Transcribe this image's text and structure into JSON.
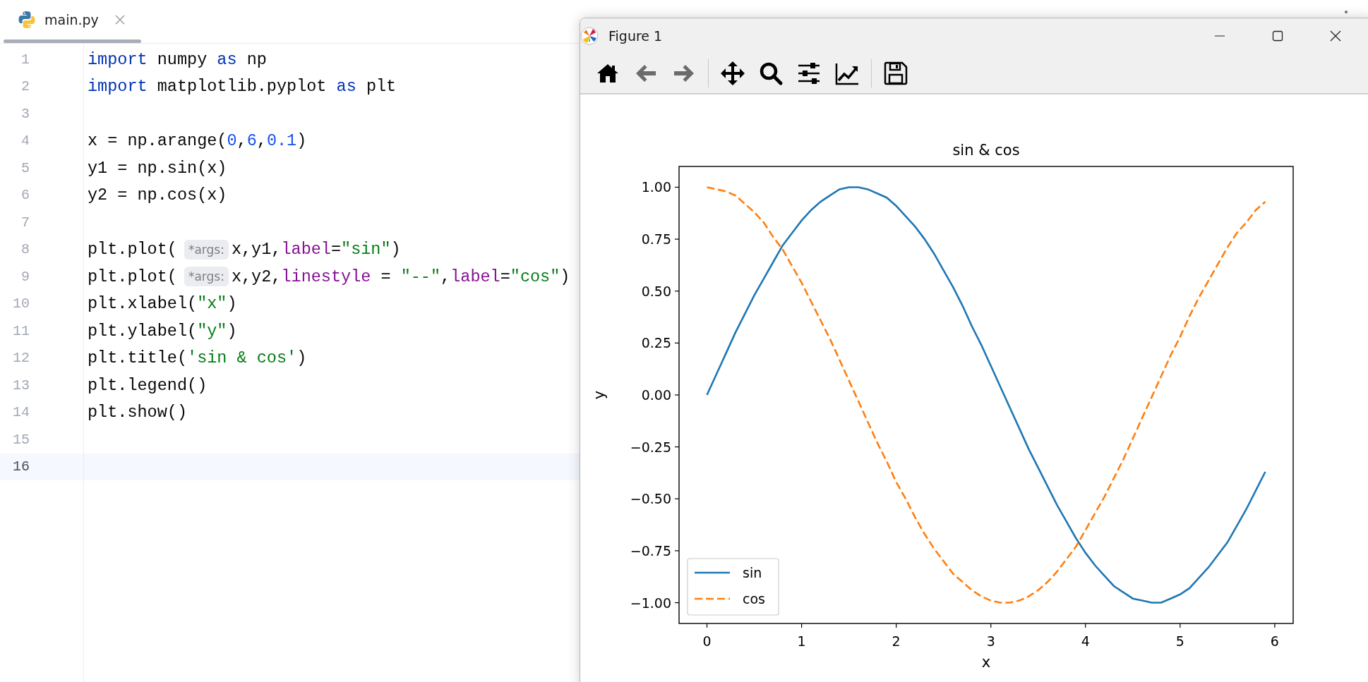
{
  "editor": {
    "tabs": [
      {
        "label": "main.py",
        "selected": true
      }
    ],
    "lines": [
      {
        "number": "1",
        "tokens": [
          {
            "kind": "keyword",
            "text": "import"
          },
          {
            "kind": "plain",
            "text": " numpy "
          },
          {
            "kind": "keyword",
            "text": "as"
          },
          {
            "kind": "plain",
            "text": " np"
          }
        ]
      },
      {
        "number": "2",
        "tokens": [
          {
            "kind": "keyword",
            "text": "import"
          },
          {
            "kind": "plain",
            "text": " matplotlib.pyplot "
          },
          {
            "kind": "keyword",
            "text": "as"
          },
          {
            "kind": "plain",
            "text": " plt"
          }
        ]
      },
      {
        "number": "3"
      },
      {
        "number": "4",
        "tokens": [
          {
            "kind": "plain",
            "text": "x = np.arange("
          },
          {
            "kind": "number",
            "text": "0"
          },
          {
            "kind": "plain",
            "text": ","
          },
          {
            "kind": "number",
            "text": "6"
          },
          {
            "kind": "plain",
            "text": ","
          },
          {
            "kind": "number",
            "text": "0.1"
          },
          {
            "kind": "plain",
            "text": ")"
          }
        ]
      },
      {
        "number": "5",
        "tokens": [
          {
            "kind": "plain",
            "text": "y1 = np.sin(x)"
          }
        ]
      },
      {
        "number": "6",
        "tokens": [
          {
            "kind": "plain",
            "text": "y2 = np.cos(x)"
          }
        ]
      },
      {
        "number": "7"
      },
      {
        "number": "8",
        "tokens": [
          {
            "kind": "plain",
            "text": "plt.plot("
          },
          {
            "kind": "hint",
            "text": "*args:"
          },
          {
            "kind": "plain",
            "text": "x,y1,"
          },
          {
            "kind": "param",
            "text": "label"
          },
          {
            "kind": "plain",
            "text": "="
          },
          {
            "kind": "string",
            "text": "\"sin\""
          },
          {
            "kind": "plain",
            "text": ")"
          }
        ]
      },
      {
        "number": "9",
        "tokens": [
          {
            "kind": "plain",
            "text": "plt.plot("
          },
          {
            "kind": "hint",
            "text": "*args:"
          },
          {
            "kind": "plain",
            "text": "x,y2,"
          },
          {
            "kind": "param",
            "text": "linestyle"
          },
          {
            "kind": "plain",
            "text": " = "
          },
          {
            "kind": "string",
            "text": "\"--\""
          },
          {
            "kind": "plain",
            "text": ","
          },
          {
            "kind": "param",
            "text": "label"
          },
          {
            "kind": "plain",
            "text": "="
          },
          {
            "kind": "string",
            "text": "\"cos\""
          },
          {
            "kind": "plain",
            "text": ")"
          }
        ]
      },
      {
        "number": "10",
        "tokens": [
          {
            "kind": "plain",
            "text": "plt.xlabel("
          },
          {
            "kind": "string",
            "text": "\"x\""
          },
          {
            "kind": "plain",
            "text": ")"
          }
        ]
      },
      {
        "number": "11",
        "tokens": [
          {
            "kind": "plain",
            "text": "plt.ylabel("
          },
          {
            "kind": "string",
            "text": "\"y\""
          },
          {
            "kind": "plain",
            "text": ")"
          }
        ]
      },
      {
        "number": "12",
        "tokens": [
          {
            "kind": "plain",
            "text": "plt.title("
          },
          {
            "kind": "string",
            "text": "'sin & cos'"
          },
          {
            "kind": "plain",
            "text": ")"
          }
        ]
      },
      {
        "number": "13",
        "tokens": [
          {
            "kind": "plain",
            "text": "plt.legend()"
          }
        ]
      },
      {
        "number": "14",
        "tokens": [
          {
            "kind": "plain",
            "text": "plt.show()"
          }
        ]
      },
      {
        "number": "15"
      },
      {
        "number": "16",
        "current": true
      }
    ]
  },
  "figure_window": {
    "title": "Figure 1",
    "toolbar": [
      {
        "kind": "home",
        "disabled": false
      },
      {
        "kind": "back",
        "disabled": true
      },
      {
        "kind": "forward",
        "disabled": true
      },
      {
        "kind": "separator"
      },
      {
        "kind": "pan",
        "disabled": false
      },
      {
        "kind": "zoom",
        "disabled": false
      },
      {
        "kind": "subplots",
        "disabled": false
      },
      {
        "kind": "edit",
        "disabled": false
      },
      {
        "kind": "separator"
      },
      {
        "kind": "save",
        "disabled": false
      }
    ],
    "chart_data": {
      "type": "line",
      "title": "sin & cos",
      "xlabel": "x",
      "ylabel": "y",
      "x": [
        0,
        0.1,
        0.2,
        0.3,
        0.4,
        0.5,
        0.6,
        0.7,
        0.8,
        0.9,
        1,
        1.1,
        1.2,
        1.3,
        1.4,
        1.5,
        1.6,
        1.7,
        1.8,
        1.9,
        2,
        2.1,
        2.2,
        2.3,
        2.4,
        2.5,
        2.6,
        2.7,
        2.8,
        2.9,
        3,
        3.1,
        3.2,
        3.3,
        3.4,
        3.5,
        3.6,
        3.7,
        3.8,
        3.9,
        4,
        4.1,
        4.2,
        4.3,
        4.4,
        4.5,
        4.6,
        4.7,
        4.8,
        4.9,
        5,
        5.1,
        5.2,
        5.3,
        5.4,
        5.5,
        5.6,
        5.7,
        5.8,
        5.9
      ],
      "series": [
        {
          "name": "sin",
          "color": "#1f77b4",
          "line_style": "solid",
          "values": [
            0,
            0.1,
            0.2,
            0.3,
            0.39,
            0.48,
            0.56,
            0.64,
            0.72,
            0.78,
            0.84,
            0.89,
            0.93,
            0.96,
            0.99,
            1,
            1,
            0.99,
            0.97,
            0.95,
            0.91,
            0.86,
            0.81,
            0.75,
            0.68,
            0.6,
            0.52,
            0.43,
            0.33,
            0.24,
            0.14,
            0.04,
            -0.06,
            -0.16,
            -0.26,
            -0.35,
            -0.44,
            -0.53,
            -0.61,
            -0.69,
            -0.76,
            -0.82,
            -0.87,
            -0.92,
            -0.95,
            -0.98,
            -0.99,
            -1,
            -1,
            -0.98,
            -0.96,
            -0.93,
            -0.88,
            -0.83,
            -0.77,
            -0.71,
            -0.63,
            -0.55,
            -0.46,
            -0.37
          ]
        },
        {
          "name": "cos",
          "color": "#ff7f0e",
          "line_style": "dashed",
          "values": [
            1,
            0.99,
            0.98,
            0.96,
            0.92,
            0.88,
            0.83,
            0.76,
            0.7,
            0.62,
            0.54,
            0.45,
            0.36,
            0.27,
            0.17,
            0.07,
            -0.03,
            -0.13,
            -0.23,
            -0.32,
            -0.42,
            -0.5,
            -0.59,
            -0.67,
            -0.74,
            -0.8,
            -0.86,
            -0.9,
            -0.94,
            -0.97,
            -0.99,
            -1,
            -1,
            -0.99,
            -0.97,
            -0.94,
            -0.9,
            -0.85,
            -0.79,
            -0.73,
            -0.65,
            -0.57,
            -0.49,
            -0.4,
            -0.31,
            -0.21,
            -0.11,
            -0.01,
            0.09,
            0.19,
            0.28,
            0.38,
            0.47,
            0.55,
            0.63,
            0.71,
            0.78,
            0.83,
            0.89,
            0.93
          ]
        }
      ],
      "legend": true,
      "xlim": [
        -0.295,
        6.195
      ],
      "ylim": [
        -1.1,
        1.1
      ],
      "xticks": [
        {
          "value": 0,
          "label": "0"
        },
        {
          "value": 1,
          "label": "1"
        },
        {
          "value": 2,
          "label": "2"
        },
        {
          "value": 3,
          "label": "3"
        },
        {
          "value": 4,
          "label": "4"
        },
        {
          "value": 5,
          "label": "5"
        },
        {
          "value": 6,
          "label": "6"
        }
      ],
      "yticks": [
        {
          "value": 1,
          "label": "1.00"
        },
        {
          "value": 0.75,
          "label": "0.75"
        },
        {
          "value": 0.5,
          "label": "0.50"
        },
        {
          "value": 0.25,
          "label": "0.25"
        },
        {
          "value": 0,
          "label": "0.00"
        },
        {
          "value": -0.25,
          "label": "−0.25"
        },
        {
          "value": -0.5,
          "label": "−0.50"
        },
        {
          "value": -0.75,
          "label": "−0.75"
        },
        {
          "value": -1,
          "label": "−1.00"
        }
      ]
    }
  }
}
